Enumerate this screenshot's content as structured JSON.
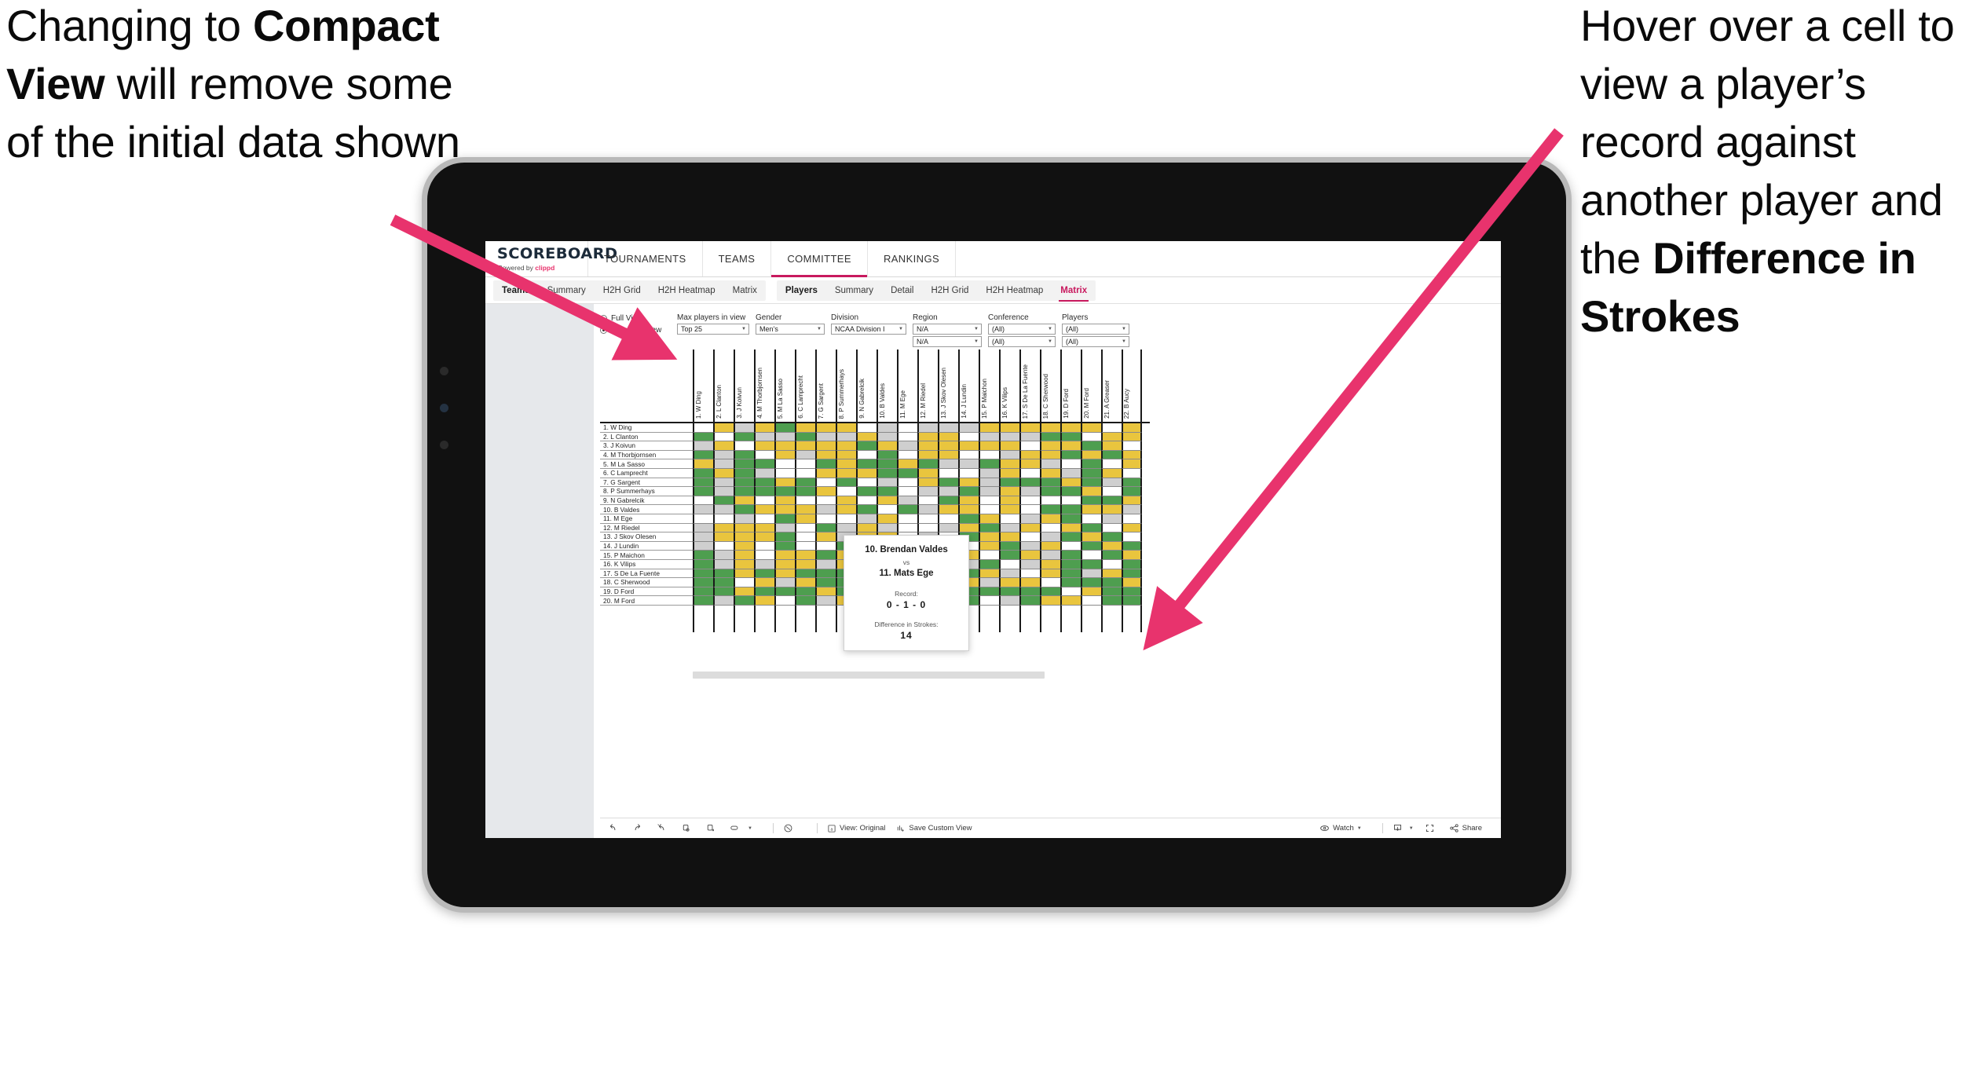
{
  "annotations": {
    "left": {
      "line1": "Changing to",
      "bold": "Compact View",
      "line2": " will remove some of the initial data shown"
    },
    "right": {
      "line1": "Hover over a cell to view a player’s record against another player and the ",
      "bold": "Difference in Strokes"
    },
    "arrow_color": "#e8336d"
  },
  "topnav": {
    "brand_name": "SCOREBOARD",
    "brand_sub_prefix": "Powered by ",
    "brand_sub_accent": "clippd",
    "items": [
      {
        "label": "TOURNAMENTS",
        "active": false
      },
      {
        "label": "TEAMS",
        "active": false
      },
      {
        "label": "COMMITTEE",
        "active": true
      },
      {
        "label": "RANKINGS",
        "active": false
      }
    ],
    "accent": "#c8195e"
  },
  "subnav": {
    "group1": [
      {
        "label": "Teams",
        "bold": true,
        "active": false
      },
      {
        "label": "Summary",
        "bold": false,
        "active": false
      },
      {
        "label": "H2H Grid",
        "bold": false,
        "active": false
      },
      {
        "label": "H2H Heatmap",
        "bold": false,
        "active": false
      },
      {
        "label": "Matrix",
        "bold": false,
        "active": false
      }
    ],
    "group2": [
      {
        "label": "Players",
        "bold": true,
        "active": false
      },
      {
        "label": "Summary",
        "bold": false,
        "active": false
      },
      {
        "label": "Detail",
        "bold": false,
        "active": false
      },
      {
        "label": "H2H Grid",
        "bold": false,
        "active": false
      },
      {
        "label": "H2H Heatmap",
        "bold": false,
        "active": false
      },
      {
        "label": "Matrix",
        "bold": false,
        "active": true
      }
    ]
  },
  "filters": {
    "view_radio": [
      {
        "label": "Full View",
        "selected": false
      },
      {
        "label": "Compact View",
        "selected": true
      }
    ],
    "fields": [
      {
        "label": "Max players in view",
        "values": [
          "Top 25"
        ],
        "width": "w1"
      },
      {
        "label": "Gender",
        "values": [
          "Men’s"
        ],
        "width": "w2"
      },
      {
        "label": "Division",
        "values": [
          "NCAA Division I"
        ],
        "width": "w3"
      },
      {
        "label": "Region",
        "values": [
          "N/A",
          "N/A"
        ],
        "width": "w4"
      },
      {
        "label": "Conference",
        "values": [
          "(All)",
          "(All)"
        ],
        "width": "w5"
      },
      {
        "label": "Players",
        "values": [
          "(All)",
          "(All)"
        ],
        "width": "w6"
      }
    ]
  },
  "matrix": {
    "column_headers": [
      "1. W Ding",
      "2. L Clanton",
      "3. J Koivun",
      "4. M Thorbjornsen",
      "5. M La Sasso",
      "6. C Lamprecht",
      "7. G Sargent",
      "8. P Summerhays",
      "9. N Gabrelcik",
      "10. B Valdes",
      "11. M Ege",
      "12. M Riedel",
      "13. J Skov Olesen",
      "14. J Lundin",
      "15. P Maichon",
      "16. K Vilips",
      "17. S De La Fuente",
      "18. C Sherwood",
      "19. D Ford",
      "20. M Ford",
      "21. A Greaser",
      "22. B Aucy"
    ],
    "row_labels": [
      "1. W Ding",
      "2. L Clanton",
      "3. J Koivun",
      "4. M Thorbjornsen",
      "5. M La Sasso",
      "6. C Lamprecht",
      "7. G Sargent",
      "8. P Summerhays",
      "9. N Gabrelcik",
      "10. B Valdes",
      "11. M Ege",
      "12. M Riedel",
      "13. J Skov Olesen",
      "14. J Lundin",
      "15. P Maichon",
      "16. K Vilips",
      "17. S De La Fuente",
      "18. C Sherwood",
      "19. D Ford",
      "20. M Ford"
    ],
    "legend_colors": {
      "win": "#4e9e4f",
      "loss": "#e9c53e",
      "tie": "#cfcfcf",
      "none": "#ffffff"
    },
    "cells": [
      [
        "w",
        "y",
        "a",
        "y",
        "g",
        "y",
        "y",
        "y",
        "w",
        "a",
        "w",
        "a",
        "a",
        "a",
        "y",
        "y",
        "y",
        "y",
        "y",
        "y",
        "w",
        "y"
      ],
      [
        "g",
        "w",
        "g",
        "a",
        "a",
        "g",
        "a",
        "a",
        "y",
        "a",
        "w",
        "y",
        "y",
        "w",
        "a",
        "a",
        "a",
        "g",
        "g",
        "w",
        "y",
        "y"
      ],
      [
        "a",
        "y",
        "w",
        "y",
        "y",
        "y",
        "y",
        "y",
        "g",
        "y",
        "a",
        "y",
        "y",
        "y",
        "y",
        "y",
        "w",
        "y",
        "y",
        "g",
        "y",
        "w"
      ],
      [
        "g",
        "a",
        "g",
        "w",
        "y",
        "a",
        "y",
        "y",
        "w",
        "g",
        "w",
        "y",
        "y",
        "w",
        "w",
        "a",
        "y",
        "y",
        "g",
        "y",
        "g",
        "y"
      ],
      [
        "y",
        "a",
        "g",
        "g",
        "w",
        "w",
        "g",
        "y",
        "g",
        "g",
        "y",
        "g",
        "a",
        "a",
        "g",
        "y",
        "y",
        "a",
        "w",
        "g",
        "w",
        "y"
      ],
      [
        "g",
        "y",
        "g",
        "a",
        "w",
        "w",
        "y",
        "y",
        "y",
        "g",
        "g",
        "y",
        "w",
        "w",
        "a",
        "y",
        "w",
        "y",
        "a",
        "g",
        "y",
        "w"
      ],
      [
        "g",
        "a",
        "g",
        "g",
        "y",
        "g",
        "w",
        "g",
        "w",
        "a",
        "w",
        "y",
        "g",
        "y",
        "a",
        "g",
        "g",
        "g",
        "y",
        "g",
        "a",
        "g"
      ],
      [
        "g",
        "a",
        "g",
        "g",
        "g",
        "g",
        "y",
        "w",
        "g",
        "g",
        "w",
        "a",
        "a",
        "g",
        "a",
        "y",
        "a",
        "g",
        "g",
        "y",
        "w",
        "g"
      ],
      [
        "w",
        "g",
        "y",
        "w",
        "y",
        "w",
        "w",
        "y",
        "w",
        "y",
        "a",
        "w",
        "g",
        "y",
        "w",
        "y",
        "w",
        "w",
        "w",
        "g",
        "g",
        "y"
      ],
      [
        "a",
        "a",
        "g",
        "y",
        "y",
        "y",
        "a",
        "y",
        "g",
        "w",
        "g",
        "a",
        "y",
        "y",
        "w",
        "y",
        "w",
        "g",
        "g",
        "y",
        "y",
        "a"
      ],
      [
        "w",
        "w",
        "a",
        "w",
        "g",
        "y",
        "w",
        "w",
        "a",
        "y",
        "w",
        "w",
        "w",
        "g",
        "y",
        "w",
        "a",
        "y",
        "g",
        "w",
        "a",
        "w"
      ],
      [
        "a",
        "y",
        "y",
        "y",
        "a",
        "w",
        "g",
        "a",
        "y",
        "a",
        "w",
        "w",
        "a",
        "y",
        "g",
        "a",
        "y",
        "w",
        "y",
        "g",
        "w",
        "y"
      ],
      [
        "a",
        "y",
        "y",
        "y",
        "g",
        "w",
        "y",
        "a",
        "y",
        "y",
        "w",
        "a",
        "w",
        "g",
        "y",
        "y",
        "w",
        "a",
        "g",
        "y",
        "g",
        "w"
      ],
      [
        "a",
        "w",
        "y",
        "w",
        "g",
        "w",
        "w",
        "g",
        "w",
        "y",
        "w",
        "y",
        "g",
        "w",
        "y",
        "g",
        "a",
        "y",
        "w",
        "g",
        "y",
        "g"
      ],
      [
        "g",
        "a",
        "y",
        "w",
        "y",
        "y",
        "g",
        "y",
        "y",
        "w",
        "y",
        "a",
        "y",
        "y",
        "w",
        "g",
        "y",
        "a",
        "g",
        "w",
        "g",
        "y"
      ],
      [
        "g",
        "a",
        "y",
        "a",
        "y",
        "y",
        "a",
        "y",
        "y",
        "y",
        "w",
        "g",
        "y",
        "a",
        "g",
        "w",
        "a",
        "y",
        "g",
        "g",
        "w",
        "g"
      ],
      [
        "g",
        "g",
        "y",
        "g",
        "y",
        "g",
        "g",
        "g",
        "g",
        "w",
        "a",
        "y",
        "w",
        "g",
        "y",
        "a",
        "w",
        "y",
        "g",
        "a",
        "y",
        "g"
      ],
      [
        "g",
        "g",
        "w",
        "y",
        "a",
        "y",
        "g",
        "g",
        "w",
        "g",
        "y",
        "w",
        "a",
        "y",
        "a",
        "y",
        "y",
        "w",
        "g",
        "g",
        "g",
        "y"
      ],
      [
        "g",
        "g",
        "y",
        "g",
        "g",
        "g",
        "y",
        "g",
        "a",
        "g",
        "g",
        "y",
        "y",
        "g",
        "g",
        "g",
        "g",
        "g",
        "w",
        "y",
        "g",
        "g"
      ],
      [
        "g",
        "a",
        "g",
        "y",
        "w",
        "g",
        "a",
        "y",
        "g",
        "g",
        "y",
        "w",
        "g",
        "g",
        "w",
        "a",
        "g",
        "y",
        "y",
        "w",
        "g",
        "g"
      ]
    ]
  },
  "tooltip": {
    "player_a": "10. Brendan Valdes",
    "vs": "vs",
    "player_b": "11. Mats Ege",
    "record_label": "Record:",
    "record_value": "0 - 1 - 0",
    "diff_label": "Difference in Strokes:",
    "diff_value": "14"
  },
  "toolbar": {
    "view_label": "View: Original",
    "save_label": "Save Custom View",
    "watch_label": "Watch",
    "share_label": "Share"
  }
}
